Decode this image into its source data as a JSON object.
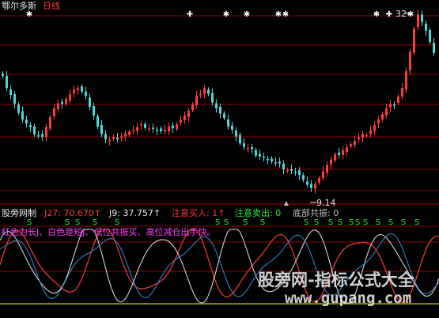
{
  "main_panel": {
    "symbol": "鄂尔多斯",
    "period": "日线",
    "high_label": "32",
    "low_label": "9.14",
    "high_value": 32,
    "low_value": 9.14,
    "star_glyph": "✱",
    "plus_glyph": "✚"
  },
  "indicator_panel": {
    "name": "股旁网制",
    "values": [
      {
        "key": "J27",
        "text": "J27: 70.670↑",
        "color": "#ff3a3a"
      },
      {
        "key": "J9",
        "text": "J9: 37.757↑",
        "color": "#e8e8e8"
      },
      {
        "key": "attention_buy",
        "text": "注意买入: 1↑",
        "color": "#ff3a3a"
      },
      {
        "key": "attention_sell",
        "text": "注意卖出: 0",
        "color": "#33e833"
      },
      {
        "key": "bottom_resonance",
        "text": "底部共振: 0",
        "color": "#c0c0c0"
      }
    ],
    "legend_text": "红色为长J、白色是短J、低位共振买、高位减仓出手快。",
    "signal_glyph": "S"
  },
  "watermark": {
    "line1": "股旁网-指标公式大全",
    "line2": "www.gupang.com"
  },
  "colors": {
    "background": "#000000",
    "bull_candle": "#ff3a3a",
    "bear_candle": "#4fd6d6",
    "grid_red": "#8a0000",
    "long_j": "#ff3a3a",
    "short_j": "#e8e8e8",
    "blue_line": "#3a8ad8",
    "baseline": "#c8c800",
    "signal": "#33e833"
  }
}
